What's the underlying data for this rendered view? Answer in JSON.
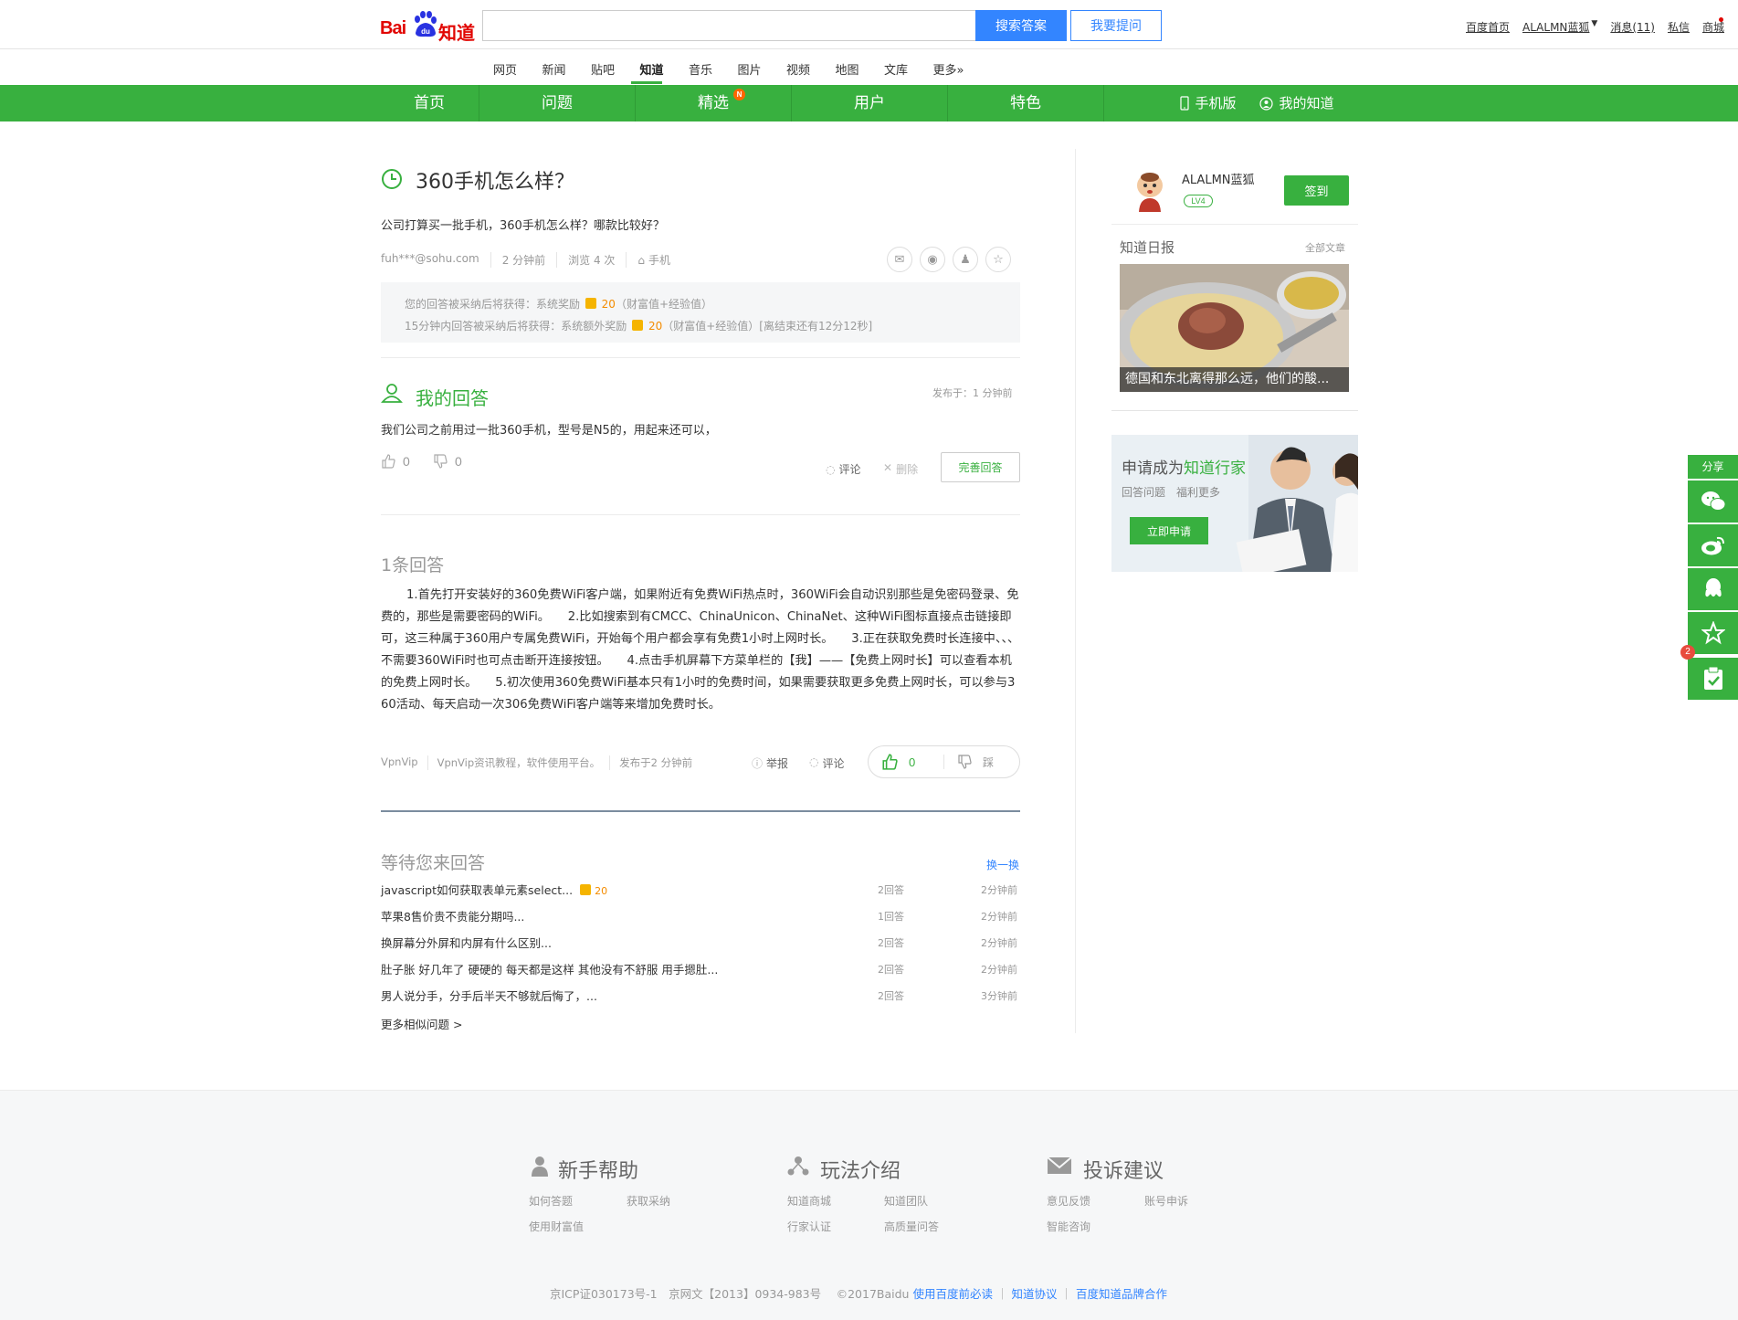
{
  "header": {
    "search_placeholder": "",
    "search_button": "搜索答案",
    "ask_button": "我要提问",
    "user_links": [
      "百度首页",
      "ALALMN蓝狐",
      "消息(11)",
      "私信",
      "商城"
    ]
  },
  "channels": [
    "网页",
    "新闻",
    "贴吧",
    "知道",
    "音乐",
    "图片",
    "视频",
    "地图",
    "文库",
    "更多»"
  ],
  "green_nav": {
    "items": [
      "首页",
      "问题",
      "精选",
      "用户",
      "特色"
    ],
    "badge": "N",
    "mobile": "手机版",
    "mine": "我的知道"
  },
  "question": {
    "title": "360手机怎么样？",
    "description": "公司打算买一批手机，360手机怎么样？哪款比较好？",
    "author": "fuh***@sohu.com",
    "time": "2 分钟前",
    "views": "浏览 4 次",
    "tag": "手机",
    "reward_line1_pre": "您的回答被采纳后将获得：系统奖励",
    "reward_line1_num": "20",
    "reward_line1_post": "（财富值+经验值）",
    "reward_line2_pre": "15分钟内回答被采纳后将获得：系统额外奖励",
    "reward_line2_num": "20",
    "reward_line2_post": "（财富值+经验值）[离结束还有12分12秒]"
  },
  "my_answer": {
    "title": "我的回答",
    "posted": "发布于：1 分钟前",
    "text": "我们公司之前用过一批360手机，型号是N5的，用起来还可以，",
    "up": "0",
    "down": "0",
    "comment": "评论",
    "delete": "删除",
    "perfect_button": "完善回答"
  },
  "answers": {
    "count": "1条回答",
    "body": "1.首先打开安装好的360免费WiFi客户端，如果附近有免费WiFi热点时，360WiFi会自动识别那些是免密码登录、免费的，那些是需要密码的WiFi。　　2.比如搜索到有CMCC、ChinaUnicon、ChinaNet、这种WiFi图标直接点击链接即可，这三种属于360用户专属免费WiFi，开始每个用户都会享有免费1小时上网时长。　　3.正在获取免费时长连接中、、、　　不需要360WiFi时也可点击断开连接按钮。　　4.点击手机屏幕下方菜单栏的【我】——【免费上网时长】可以查看本机的免费上网时长。　　5.初次使用360免费WiFi基本只有1小时的免费时间，如果需要获取更多免费上网时长，可以参与360活动、每天启动一次306免费WiFi客户端等来增加免费时长。",
    "author": "VpnVip",
    "author_desc": "VpnVip资讯教程，软件使用平台。",
    "time": "发布于2 分钟前",
    "report": "举报",
    "comment": "评论",
    "likes": "0",
    "dislike": "踩"
  },
  "waiting": {
    "title": "等待您来回答",
    "swap": "换一换",
    "items": [
      {
        "q": "javascript如何获取表单元素select...",
        "reward": "20",
        "count": "2回答",
        "time": "2分钟前"
      },
      {
        "q": "苹果8售价贵不贵能分期吗...",
        "reward": "",
        "count": "1回答",
        "time": "2分钟前"
      },
      {
        "q": "换屏幕分外屏和内屏有什么区别...",
        "reward": "",
        "count": "2回答",
        "time": "2分钟前"
      },
      {
        "q": "肚子胀 好几年了 硬硬的 每天都是这样 其他没有不舒服 用手摁肚...",
        "reward": "",
        "count": "2回答",
        "time": "2分钟前"
      },
      {
        "q": "男人说分手，分手后半天不够就后悔了，...",
        "reward": "",
        "count": "2回答",
        "time": "3分钟前"
      }
    ],
    "more": "更多相似问题 >"
  },
  "sidebar": {
    "username": "ALALMN蓝狐",
    "level": "LV4",
    "signin": "签到",
    "daily_title": "知道日报",
    "all_articles": "全部文章",
    "daily_caption": "德国和东北离得那么远，他们的酸...",
    "expert_title_pre": "申请成为",
    "expert_title_em": "知道行家",
    "expert_sub": "回答问题　福利更多",
    "apply": "立即申请"
  },
  "share_bar": {
    "label": "分享",
    "badge": "2"
  },
  "footer": {
    "sections": [
      {
        "title": "新手帮助",
        "links": [
          "如何答题",
          "获取采纳",
          "使用财富值"
        ]
      },
      {
        "title": "玩法介绍",
        "links": [
          "知道商城",
          "知道团队",
          "行家认证",
          "高质量问答"
        ]
      },
      {
        "title": "投诉建议",
        "links": [
          "意见反馈",
          "账号申诉",
          "智能咨询"
        ]
      }
    ],
    "copyright_plain": "京ICP证030173号-1　京网文【2013】0934-983号　 ©2017Baidu ",
    "copyright_links": [
      "使用百度前必读",
      "知道协议",
      "百度知道品牌合作"
    ]
  },
  "colors": {
    "green": "#38b03f",
    "blue": "#3385ff",
    "orange": "#f48c00",
    "red": "#e10602"
  }
}
